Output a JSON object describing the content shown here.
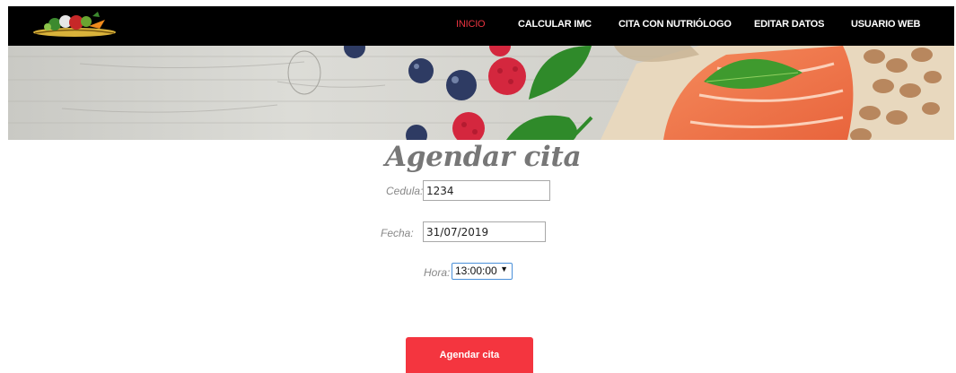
{
  "nav": {
    "items": [
      {
        "label": "INICIO",
        "active": true
      },
      {
        "label": "CALCULAR IMC",
        "active": false
      },
      {
        "label": "CITA CON NUTRIÓLOGO",
        "active": false
      },
      {
        "label": "EDITAR DATOS",
        "active": false
      },
      {
        "label": "USUARIO WEB",
        "active": false
      }
    ]
  },
  "form": {
    "title": "Agendar cita",
    "cedula_label": "Cedula:",
    "cedula_value": "1234",
    "fecha_label": "Fecha:",
    "fecha_value": "31/07/2019",
    "hora_label": "Hora:",
    "hora_value": "13:00:00",
    "submit_label": "Agendar cita"
  },
  "colors": {
    "accent": "#f4353f",
    "nav_active": "#e8333f",
    "nav_bg": "#000000"
  }
}
